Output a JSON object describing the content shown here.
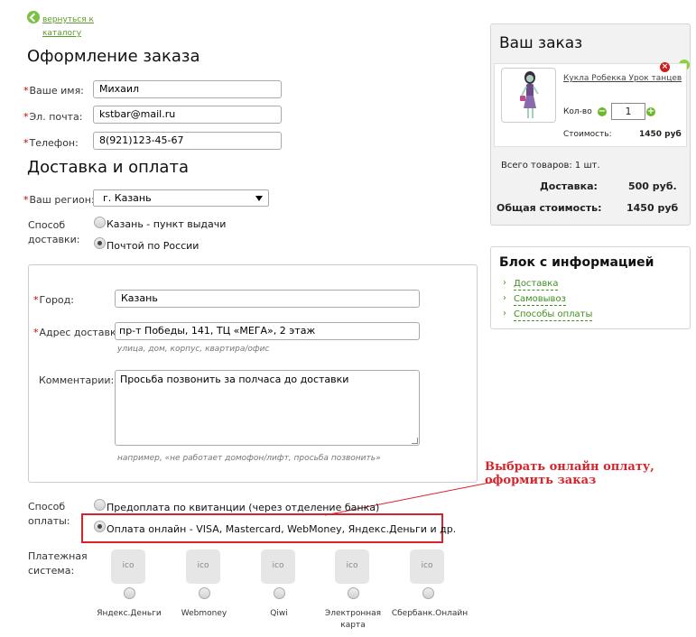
{
  "back": {
    "label": "вернуться к каталогу"
  },
  "checkout": {
    "title": "Оформление заказа",
    "name": {
      "label": "Ваше имя:",
      "value": "Михаил"
    },
    "email": {
      "label": "Эл. почта:",
      "value": "kstbar@mail.ru"
    },
    "phone": {
      "label": "Телефон:",
      "value": "8(921)123-45-67"
    }
  },
  "delivery": {
    "title": "Доставка и оплата",
    "region": {
      "label": "Ваш регион:",
      "value": "г. Казань"
    },
    "method": {
      "label_line1": "Способ",
      "label_line2": "доставки:",
      "options": [
        {
          "label": "Казань - пункт выдачи",
          "selected": false
        },
        {
          "label": "Почтой по России",
          "selected": true
        }
      ]
    },
    "city": {
      "label": "Город:",
      "value": "Казань"
    },
    "address": {
      "label": "Адрес доставки:",
      "value": "пр-т Победы, 141, ТЦ «МЕГА», 2 этаж",
      "hint": "улица, дом, корпус, квартира/офис"
    },
    "comment": {
      "label": "Комментарии:",
      "value": "Просьба позвонить за полчаса до доставки",
      "hint": "например, «не работает домофон/лифт, просьба позвонить»"
    }
  },
  "payment": {
    "label_line1": "Способ",
    "label_line2": "оплаты:",
    "options": [
      {
        "label": "Предоплата по квитанции (через отделение банка)",
        "selected": false
      },
      {
        "label": "Оплата онлайн - VISA, Mastercard, WebMoney, Яндекс.Деньги и др.",
        "selected": true
      }
    ],
    "system_label_line1": "Платежная",
    "system_label_line2": "система:",
    "systems": [
      {
        "tile": "ico",
        "name": "Яндекс.Деньги"
      },
      {
        "tile": "ico",
        "name": "Webmoney"
      },
      {
        "tile": "ico",
        "name": "Qiwi"
      },
      {
        "tile": "ico",
        "name_line1": "Электронная",
        "name_line2": "карта"
      },
      {
        "tile": "ico",
        "name": "Сбербанк.Онлайн"
      }
    ]
  },
  "annotation": {
    "line1": "Выбрать онлайн оплату,",
    "line2": "оформить заказ",
    "color": "#d8232a"
  },
  "order": {
    "title": "Ваш заказ",
    "item": {
      "name": "Кукла Робекка Урок танцев",
      "qty_label": "Кол-во",
      "qty": "1",
      "cost_label": "Стоимость:",
      "cost": "1450 руб"
    },
    "total_items": "Всего товаров: 1 шт.",
    "delivery_label": "Доставка:",
    "delivery_value": "500 руб.",
    "total_label": "Общая стоимость:",
    "total_value": "1450 руб"
  },
  "info": {
    "title": "Блок с информацией",
    "links": [
      "Доставка",
      "Самовывоз",
      "Способы оплаты"
    ]
  },
  "colors": {
    "accent_green": "#7bc143",
    "required": "#cc0000",
    "link_green": "#3f8f1e"
  }
}
